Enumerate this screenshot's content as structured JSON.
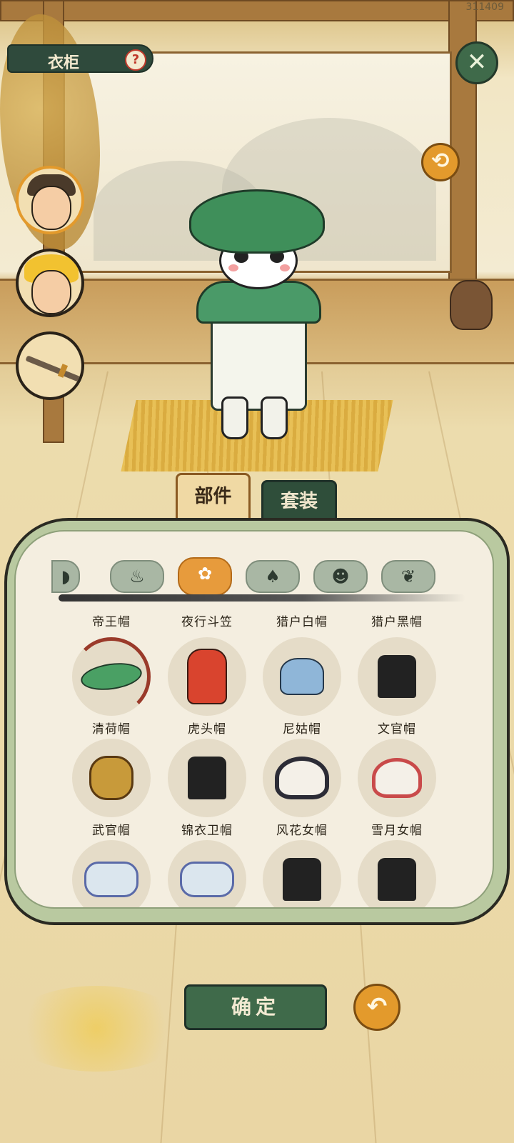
{
  "screen": {
    "id_label": "311409"
  },
  "header": {
    "title": "衣柜",
    "help_icon": "?",
    "close_icon": "✕",
    "refresh_icon": "⟲"
  },
  "character_select": [
    {
      "name": "hero-portrait",
      "selected": true
    },
    {
      "name": "golden-hair-portrait",
      "selected": false
    },
    {
      "name": "weapon-sword",
      "selected": false
    }
  ],
  "tabs": [
    {
      "label": "部件",
      "active": true
    },
    {
      "label": "套装",
      "active": false
    }
  ],
  "categories": [
    {
      "icon": "partial-left-icon",
      "glyph": "◗"
    },
    {
      "icon": "robe-icon",
      "glyph": "♨"
    },
    {
      "icon": "hat-flower-icon",
      "glyph": "✿",
      "selected": true
    },
    {
      "icon": "bag-icon",
      "glyph": "♠"
    },
    {
      "icon": "head-icon",
      "glyph": "☻"
    },
    {
      "icon": "leaf-icon",
      "glyph": "❦"
    }
  ],
  "items_top_row_names": [
    "帝王帽",
    "夜行斗笠",
    "猎户白帽",
    "猎户黑帽"
  ],
  "items": [
    {
      "label": "清荷帽",
      "style": "leaf",
      "selected": true
    },
    {
      "label": "虎头帽",
      "style": "tiger"
    },
    {
      "label": "尼姑帽",
      "style": "blue"
    },
    {
      "label": "文官帽",
      "style": "black"
    },
    {
      "label": "武官帽",
      "style": "gold"
    },
    {
      "label": "锦衣卫帽",
      "style": "black"
    },
    {
      "label": "风花女帽",
      "style": "ring"
    },
    {
      "label": "雪月女帽",
      "style": "ring2"
    },
    {
      "label": "",
      "style": "wrap"
    },
    {
      "label": "",
      "style": "wrap"
    },
    {
      "label": "",
      "style": "black"
    },
    {
      "label": "",
      "style": "black"
    }
  ],
  "footer": {
    "confirm_label": "确定",
    "undo_icon": "↶"
  },
  "colors": {
    "accent": "#e39a2c",
    "dark_green": "#3f6a4a",
    "panel": "#f4eee0"
  }
}
